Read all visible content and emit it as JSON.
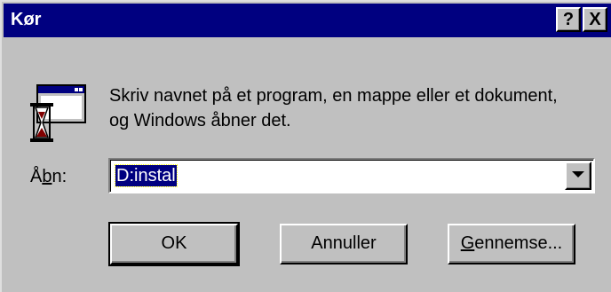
{
  "window": {
    "title": "Kør",
    "help_label": "?",
    "close_label": "X"
  },
  "message": {
    "line1": "Skriv navnet på et program, en mappe eller et dokument,",
    "line2": "og Windows åbner det."
  },
  "open_field": {
    "label_prefix": "Å",
    "label_accel": "b",
    "label_suffix": "n:",
    "value": "D:instal"
  },
  "buttons": {
    "ok": "OK",
    "cancel": "Annuller",
    "browse_accel": "G",
    "browse_rest": "ennemse..."
  },
  "icons": {
    "program": "run-program-icon",
    "dropdown": "dropdown-arrow-icon"
  }
}
